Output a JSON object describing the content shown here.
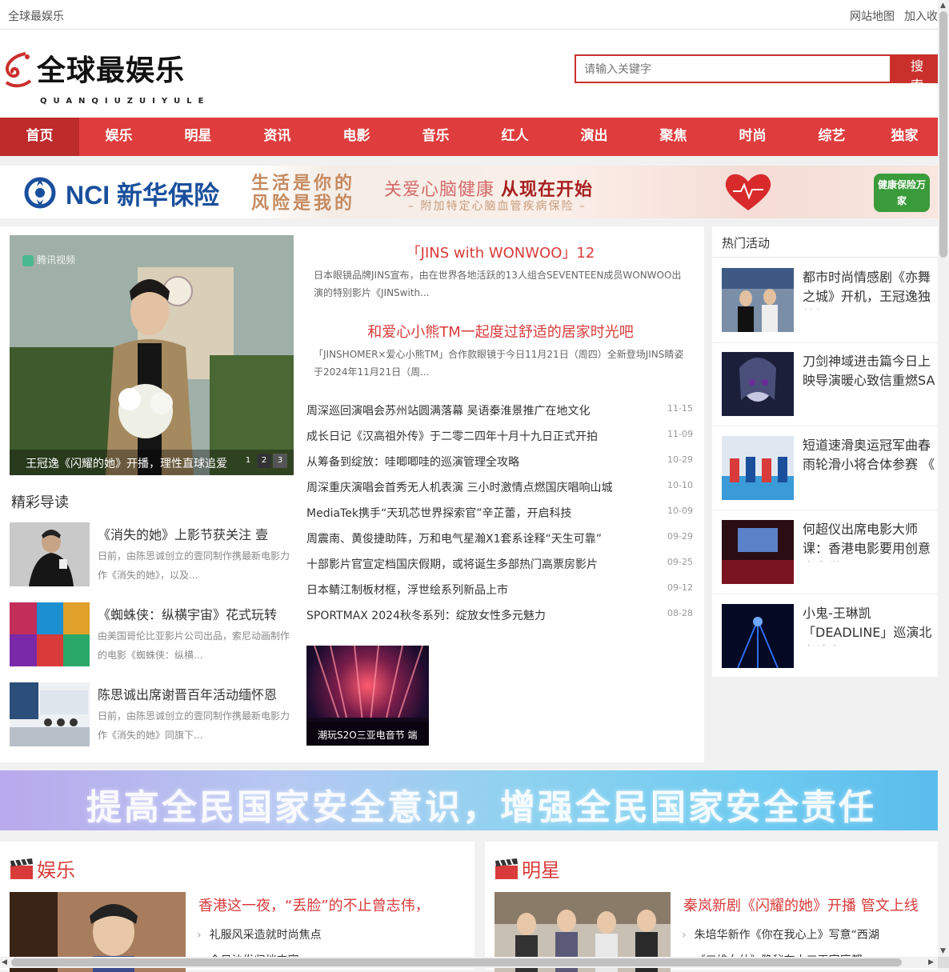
{
  "topbar": {
    "site_name": "全球最娱乐",
    "links": [
      "网站地图",
      "加入收藏"
    ]
  },
  "logo": {
    "title": "全球最娱乐",
    "subtitle": "QUANQIUZUIYULE"
  },
  "search": {
    "placeholder": "请输入关键字",
    "button": "搜 索"
  },
  "nav": [
    {
      "label": "首页",
      "active": true
    },
    {
      "label": "娱乐"
    },
    {
      "label": "明星"
    },
    {
      "label": "资讯"
    },
    {
      "label": "电影"
    },
    {
      "label": "音乐"
    },
    {
      "label": "红人"
    },
    {
      "label": "演出"
    },
    {
      "label": "聚焦"
    },
    {
      "label": "时尚"
    },
    {
      "label": "综艺"
    },
    {
      "label": "独家"
    }
  ],
  "banner_ad": {
    "brand": "NCI 新华保险",
    "slogan_line1": "生活是你的",
    "slogan_line2": "风险是我的",
    "care": "关爱心脑健康",
    "care_bold": "从现在开始",
    "care_sub": "– 附加特定心脑血管疾病保险 –",
    "badge": "健康保险万家"
  },
  "slider": {
    "caption": "王冠逸《闪耀的她》开播，理性直球追爱",
    "watermark": "腾讯视频",
    "dots": [
      "1",
      "2",
      "3"
    ],
    "active_dot": "2"
  },
  "featured_reading": {
    "title": "精彩导读",
    "items": [
      {
        "title": "《消失的她》上影节获关注 壹",
        "desc": "日前，由陈思诚创立的壹同制作携最新电影力作《消失的她》，以及..."
      },
      {
        "title": "《蜘蛛侠：纵横宇宙》花式玩转",
        "desc": "由美国哥伦比亚影片公司出品，索尼动画制作的电影《蜘蛛侠：纵横..."
      },
      {
        "title": "陈思诚出席谢晋百年活动缅怀恩",
        "desc": "日前，由陈思诚创立的壹同制作携最新电影力作《消失的她》同旗下..."
      }
    ]
  },
  "headlines": [
    {
      "title": "「JINS with WONWOO」12",
      "desc": "日本眼镜品牌JINS宣布，由在世界各地活跃的13人组合SEVENTEEN成员WONWOO出演的特别影片《JINSwith..."
    },
    {
      "title": "和爱心小熊TM一起度过舒适的居家时光吧",
      "desc": "「JINSHOMER×爱心小熊TM」合作款眼镜于今日11月21日（周四）全新登场JINS睛姿于2024年11月21日（周..."
    }
  ],
  "news_list": [
    {
      "title": "周深巡回演唱会苏州站圆满落幕 吴语秦淮景推广在地文化",
      "date": "11-15"
    },
    {
      "title": "成长日记《汉高祖外传》于二零二四年十月十九日正式开拍",
      "date": "11-09"
    },
    {
      "title": "从筹备到绽放：哇唧唧哇的巡演管理全攻略",
      "date": "10-29"
    },
    {
      "title": "周深重庆演唱会首秀无人机表演 三小时激情点燃国庆唱响山城",
      "date": "10-10"
    },
    {
      "title": "MediaTek携手“天玑芯世界探索官”辛芷蕾，开启科技",
      "date": "10-09"
    },
    {
      "title": "周震南、黄俊捷助阵，万和电气星瀚X1套系诠释“天生可靠”",
      "date": "09-29"
    },
    {
      "title": "十部影片官宣定档国庆假期，或将诞生多部热门高票房影片",
      "date": "09-25"
    },
    {
      "title": "日本鲭江制板材框，浮世绘系列新品上市",
      "date": "09-12"
    },
    {
      "title": "SPORTMAX 2024秋冬系列：绽放女性多元魅力",
      "date": "08-28"
    }
  ],
  "feature_image": {
    "caption": "潮玩S2O三亚电音节 端"
  },
  "hot_activities": {
    "title": "热门活动",
    "items": [
      {
        "title": "都市时尚情感剧《亦舞之城》开机，王冠逸独特初"
      },
      {
        "title": "刀剑神域进击篇今日上映导演暖心致信重燃SA"
      },
      {
        "title": "短道速滑奥运冠军曲春雨轮滑小将合体参赛 《"
      },
      {
        "title": "何超仪出席电影大师课：香港电影要用创意走向世"
      },
      {
        "title": "小鬼-王琳凯「DEADLINE」巡演北京站来"
      }
    ]
  },
  "banner_slogan": {
    "text": "提高全民国家安全意识，增强全民国家安全责任"
  },
  "sections": [
    {
      "title": "娱乐",
      "lead": "香港这一夜，“丢脸”的不止曾志伟，",
      "items": [
        "礼服风采造就时尚焦点",
        "今日沙发归档丰富"
      ]
    },
    {
      "title": "明星",
      "lead": "秦岚新剧《闪耀的她》开播 管文上线",
      "items": [
        "朱培华新作《你在我心上》写意“西湖",
        "《三维女仙》隐秘在大三天家庭都"
      ]
    }
  ]
}
